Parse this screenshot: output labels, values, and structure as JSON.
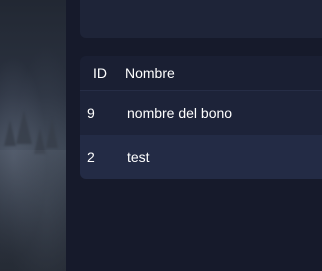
{
  "table": {
    "headers": {
      "id": "ID",
      "name": "Nombre"
    },
    "rows": [
      {
        "id": "9",
        "name": "nombre del bono"
      },
      {
        "id": "2",
        "name": "test"
      }
    ]
  }
}
